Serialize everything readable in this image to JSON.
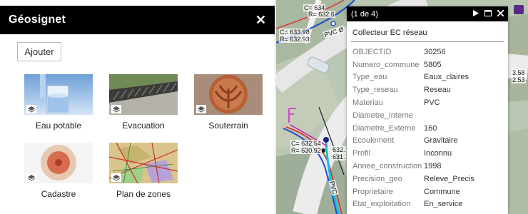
{
  "panel": {
    "title": "Géosignet",
    "close": "✕",
    "add_label": "Ajouter",
    "bookmarks": [
      {
        "label": "Eau potable"
      },
      {
        "label": "Evacuation"
      },
      {
        "label": "Souterrain"
      },
      {
        "label": "Cadastre"
      },
      {
        "label": "Plan de zones"
      }
    ]
  },
  "map": {
    "labels": [
      "C= 634",
      "R= 632.6",
      "PVC Ø",
      "C= 633.98",
      "R= 632.93",
      "C= 632.54",
      "R= 630.92",
      "632.",
      "631.",
      "3.58",
      "2.53",
      "PVC"
    ]
  },
  "popup": {
    "counter": "(1 de 4)",
    "title": "Collecteur EC réseau",
    "attributes": [
      {
        "key": "OBJECTID",
        "value": "30256"
      },
      {
        "key": "Numero_commune",
        "value": "5805"
      },
      {
        "key": "Type_eau",
        "value": "Eaux_claires"
      },
      {
        "key": "Type_reseau",
        "value": "Reseau"
      },
      {
        "key": "Materiau",
        "value": "PVC"
      },
      {
        "key": "Diametre_Interne",
        "value": ""
      },
      {
        "key": "Diametre_Externe",
        "value": "160"
      },
      {
        "key": "Ecoulement",
        "value": "Gravitaire"
      },
      {
        "key": "Profil",
        "value": "Inconnu"
      },
      {
        "key": "Annee_construction",
        "value": "1998"
      },
      {
        "key": "Precision_geo",
        "value": "Releve_Precis"
      },
      {
        "key": "Proprietaire",
        "value": "Commune"
      },
      {
        "key": "Etat_exploitation",
        "value": "En_service"
      }
    ]
  }
}
